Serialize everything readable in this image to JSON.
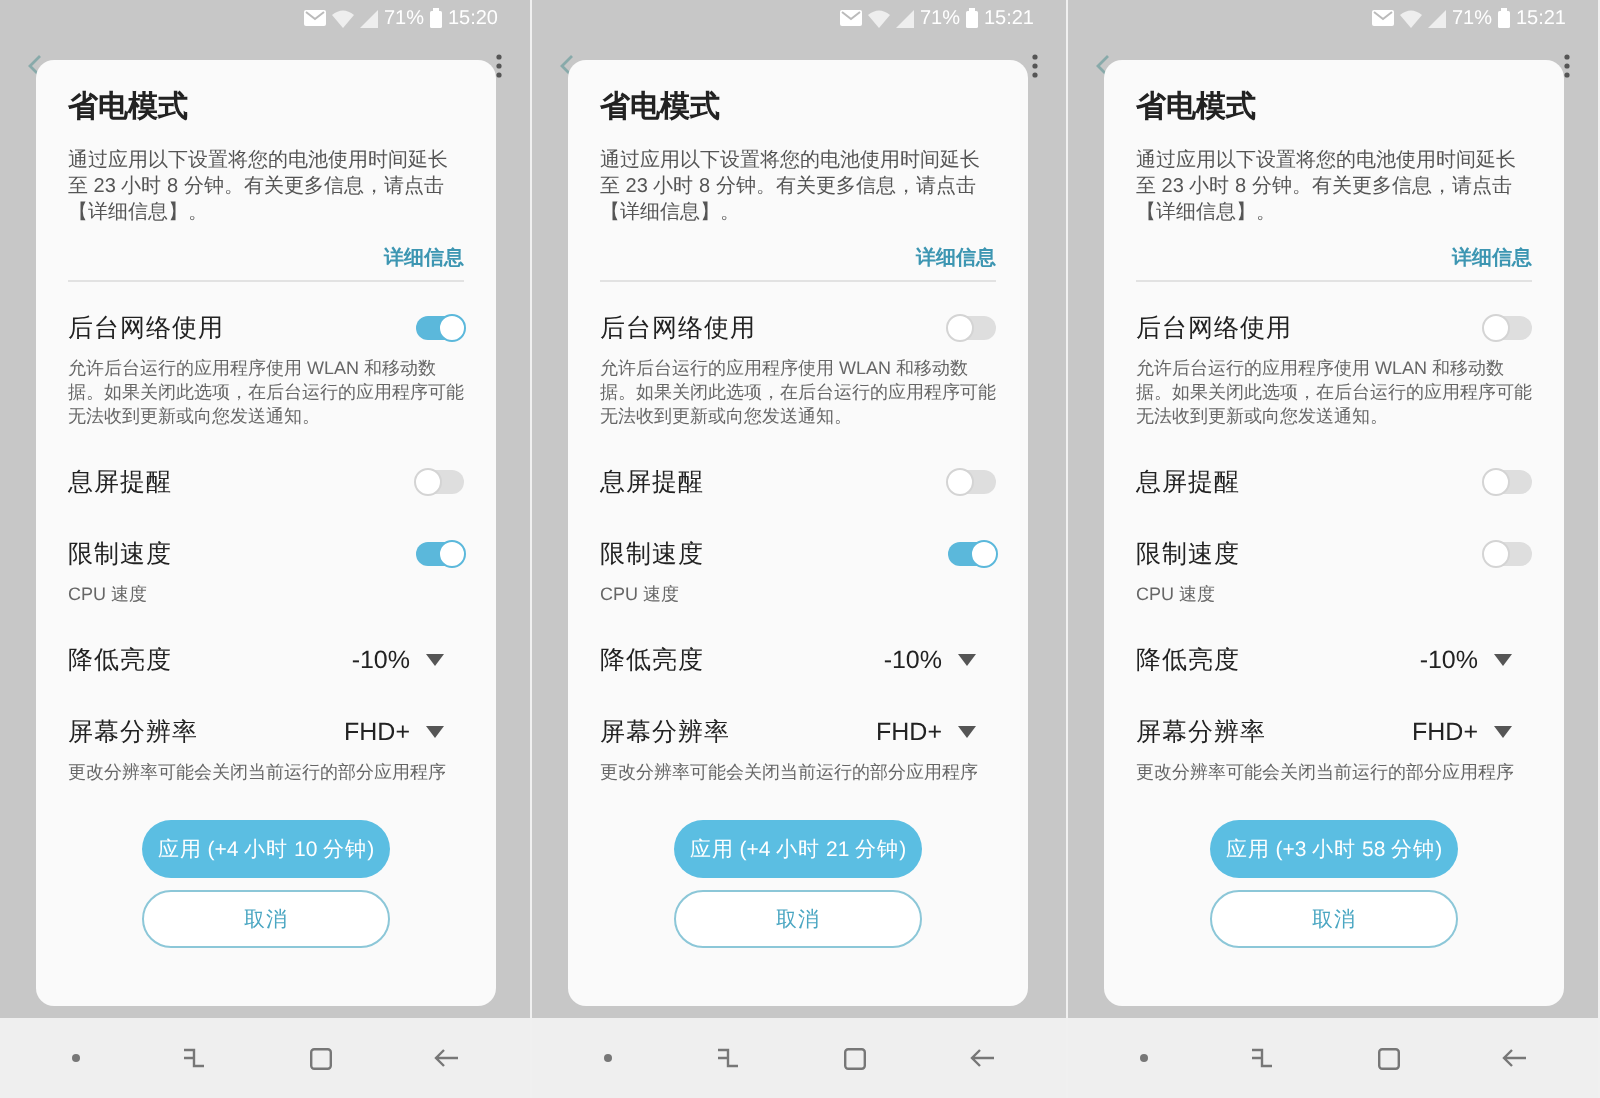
{
  "panels": [
    {
      "status_bar": {
        "battery": "71%",
        "time": "15:20"
      },
      "dialog": {
        "title": "省电模式",
        "description": "通过应用以下设置将您的电池使用时间延长至 23 小时 8 分钟。有关更多信息，请点击【详细信息】。",
        "more_link": "详细信息",
        "settings": [
          {
            "kind": "toggle",
            "label": "后台网络使用",
            "on": true,
            "description": "允许后台运行的应用程序使用 WLAN 和移动数据。如果关闭此选项，在后台运行的应用程序可能无法收到更新或向您发送通知。"
          },
          {
            "kind": "toggle",
            "label": "息屏提醒",
            "on": false
          },
          {
            "kind": "toggle",
            "label": "限制速度",
            "on": true,
            "description": "CPU 速度"
          },
          {
            "kind": "dropdown",
            "label": "降低亮度",
            "value": "-10%"
          },
          {
            "kind": "dropdown",
            "label": "屏幕分辨率",
            "value": "FHD+",
            "description": "更改分辨率可能会关闭当前运行的部分应用程序"
          }
        ],
        "apply_button": "应用 (+4 小时 10 分钟)",
        "cancel_button": "取消"
      }
    },
    {
      "status_bar": {
        "battery": "71%",
        "time": "15:21"
      },
      "dialog": {
        "title": "省电模式",
        "description": "通过应用以下设置将您的电池使用时间延长至 23 小时 8 分钟。有关更多信息，请点击【详细信息】。",
        "more_link": "详细信息",
        "settings": [
          {
            "kind": "toggle",
            "label": "后台网络使用",
            "on": false,
            "description": "允许后台运行的应用程序使用 WLAN 和移动数据。如果关闭此选项，在后台运行的应用程序可能无法收到更新或向您发送通知。"
          },
          {
            "kind": "toggle",
            "label": "息屏提醒",
            "on": false
          },
          {
            "kind": "toggle",
            "label": "限制速度",
            "on": true,
            "description": "CPU 速度"
          },
          {
            "kind": "dropdown",
            "label": "降低亮度",
            "value": "-10%"
          },
          {
            "kind": "dropdown",
            "label": "屏幕分辨率",
            "value": "FHD+",
            "description": "更改分辨率可能会关闭当前运行的部分应用程序"
          }
        ],
        "apply_button": "应用 (+4 小时 21 分钟)",
        "cancel_button": "取消"
      }
    },
    {
      "status_bar": {
        "battery": "71%",
        "time": "15:21"
      },
      "dialog": {
        "title": "省电模式",
        "description": "通过应用以下设置将您的电池使用时间延长至 23 小时 8 分钟。有关更多信息，请点击【详细信息】。",
        "more_link": "详细信息",
        "settings": [
          {
            "kind": "toggle",
            "label": "后台网络使用",
            "on": false,
            "description": "允许后台运行的应用程序使用 WLAN 和移动数据。如果关闭此选项，在后台运行的应用程序可能无法收到更新或向您发送通知。"
          },
          {
            "kind": "toggle",
            "label": "息屏提醒",
            "on": false
          },
          {
            "kind": "toggle",
            "label": "限制速度",
            "on": false,
            "description": "CPU 速度"
          },
          {
            "kind": "dropdown",
            "label": "降低亮度",
            "value": "-10%"
          },
          {
            "kind": "dropdown",
            "label": "屏幕分辨率",
            "value": "FHD+",
            "description": "更改分辨率可能会关闭当前运行的部分应用程序"
          }
        ],
        "apply_button": "应用 (+3 小时 58 分钟)",
        "cancel_button": "取消"
      }
    }
  ]
}
